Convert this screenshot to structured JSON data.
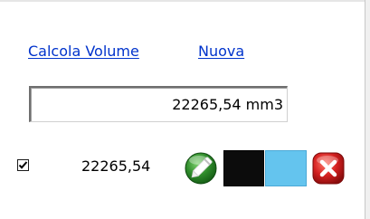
{
  "links": {
    "calcola_volume": "Calcola Volume",
    "nuova": "Nuova"
  },
  "result": {
    "value": "22265,54 mm3"
  },
  "row": {
    "checked": true,
    "value": "22265,54",
    "icons": {
      "edit": "pencil-icon",
      "delete": "close-icon"
    },
    "colors": {
      "swatch_1": "#0c0c0c",
      "swatch_2": "#64c4ee",
      "edit_button": "#2e8a2a",
      "delete_button": "#d42020"
    }
  }
}
